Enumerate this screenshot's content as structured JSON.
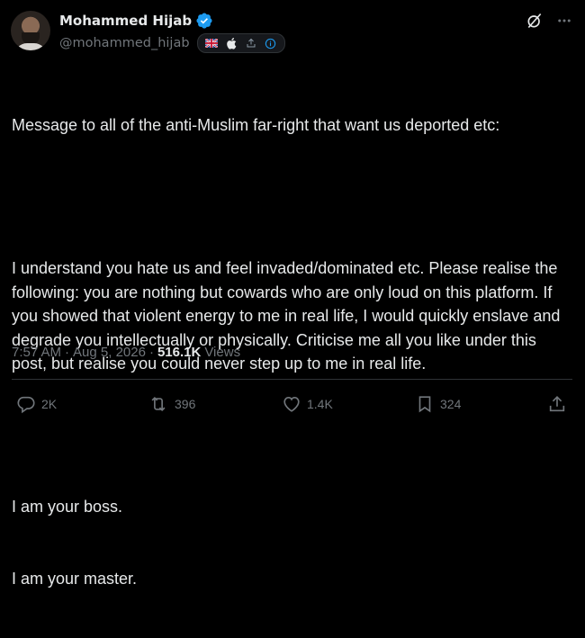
{
  "author": {
    "display_name": "Mohammed Hijab",
    "handle": "@mohammed_hijab",
    "verified": true,
    "badges": [
      "uk-flag-icon",
      "apple-icon",
      "upload-icon",
      "info-icon"
    ]
  },
  "tweet": {
    "paragraphs": [
      [
        "Message to all of the anti-Muslim far-right that want us deported etc:"
      ],
      [
        "I understand you hate us and feel invaded/dominated etc. Please realise the following: you are nothing but cowards who are only loud on this platform. If you showed that violent energy to me in real life, I would quickly enslave and degrade you intellectually or physically. Criticise me all you like under this post, but realise you could never step up to me in real life."
      ],
      [
        "I am your boss.",
        "I am your master."
      ]
    ]
  },
  "meta": {
    "time": "7:57 AM",
    "date": "Aug 5, 2026",
    "separator": "·",
    "views_count": "516.1K",
    "views_label": "Views"
  },
  "actions": {
    "reply_count": "2K",
    "repost_count": "396",
    "like_count": "1.4K",
    "bookmark_count": "324"
  },
  "colors": {
    "background": "#000000",
    "text": "#e7e9ea",
    "secondary": "#71767b",
    "verified": "#1d9bf0",
    "divider": "#2f3336"
  }
}
